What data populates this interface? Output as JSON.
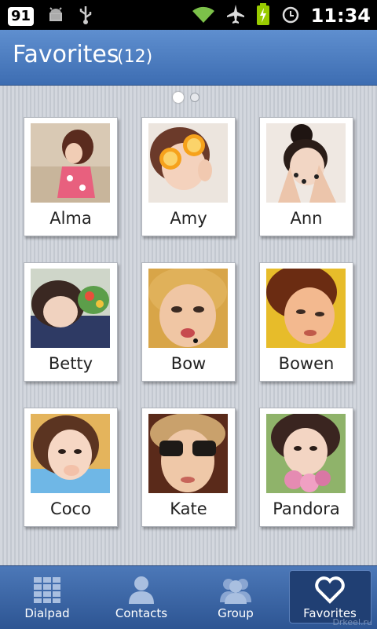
{
  "status_bar": {
    "notification_badge": "91",
    "icons": [
      "android-debug-icon",
      "usb-icon",
      "wifi-icon",
      "airplane-icon",
      "battery-charging-icon",
      "alarm-icon"
    ],
    "time": "11:34"
  },
  "header": {
    "title": "Favorites",
    "count": "(12)",
    "color": "#4a7cc0"
  },
  "pager": {
    "pages": 2,
    "current": 1
  },
  "favorites": [
    {
      "name": "Alma"
    },
    {
      "name": "Amy"
    },
    {
      "name": "Ann"
    },
    {
      "name": "Betty"
    },
    {
      "name": "Bow"
    },
    {
      "name": "Bowen"
    },
    {
      "name": "Coco"
    },
    {
      "name": "Kate"
    },
    {
      "name": "Pandora"
    }
  ],
  "tabs": [
    {
      "label": "Dialpad",
      "icon": "dialpad-icon"
    },
    {
      "label": "Contacts",
      "icon": "contact-icon"
    },
    {
      "label": "Group",
      "icon": "group-icon"
    },
    {
      "label": "Favorites",
      "icon": "heart-icon",
      "selected": true
    }
  ],
  "watermark": "Drkeel.ru"
}
